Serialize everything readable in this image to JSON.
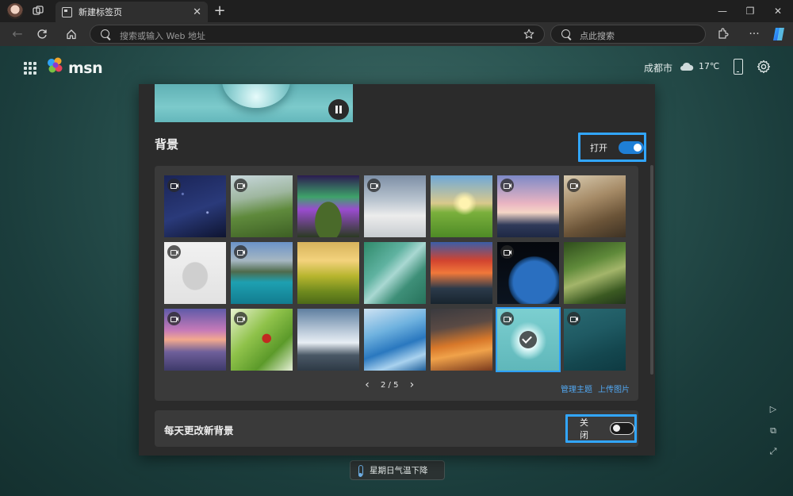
{
  "browser": {
    "tab_title": "新建标签页",
    "tab_close": "✕",
    "new_tab": "+",
    "address_placeholder": "搜索或输入 Web 地址",
    "search_placeholder": "点此搜索",
    "minimize": "—",
    "restore": "❐",
    "close": "✕"
  },
  "header": {
    "logo_text": "msn",
    "city": "成都市",
    "temperature": "17℃"
  },
  "background_panel": {
    "title": "背景",
    "toggle_label": "打开",
    "toggle_on": true,
    "page_indicator": "2 / 5",
    "manage_themes": "管理主题",
    "upload_image": "上传图片",
    "daily_title": "每天更改新背景",
    "daily_toggle_label": "关闭",
    "daily_toggle_on": false,
    "thumbnails": [
      {
        "scene": "starry-night-sky",
        "video": true,
        "selected": false
      },
      {
        "scene": "green-mountain-ridge",
        "video": true,
        "selected": false
      },
      {
        "scene": "aurora-over-mountain",
        "video": false,
        "selected": false
      },
      {
        "scene": "misty-mountains",
        "video": true,
        "selected": false
      },
      {
        "scene": "sunrise-over-meadow",
        "video": false,
        "selected": false
      },
      {
        "scene": "cliffside-sunset-village",
        "video": true,
        "selected": false
      },
      {
        "scene": "llamas",
        "video": true,
        "selected": false
      },
      {
        "scene": "white-sculpture",
        "video": true,
        "selected": false
      },
      {
        "scene": "turquoise-lake-mountains",
        "video": true,
        "selected": false
      },
      {
        "scene": "golden-hills",
        "video": false,
        "selected": false
      },
      {
        "scene": "aerial-coastline",
        "video": false,
        "selected": false
      },
      {
        "scene": "red-sky-islands",
        "video": false,
        "selected": false
      },
      {
        "scene": "planet-earth",
        "video": true,
        "selected": false
      },
      {
        "scene": "forest-path",
        "video": false,
        "selected": false
      },
      {
        "scene": "pier-at-sunset",
        "video": true,
        "selected": false
      },
      {
        "scene": "ladybug-on-leaf",
        "video": true,
        "selected": false
      },
      {
        "scene": "rocky-shore-mist",
        "video": false,
        "selected": false
      },
      {
        "scene": "iceberg-blue",
        "video": false,
        "selected": false
      },
      {
        "scene": "orange-desert-dunes",
        "video": false,
        "selected": false
      },
      {
        "scene": "water-droplet",
        "video": true,
        "selected": true
      },
      {
        "scene": "ocean-surface",
        "video": true,
        "selected": false
      }
    ]
  },
  "weather_pill": {
    "text": "星期日气温下降"
  },
  "colors": {
    "accent": "#32a6ff",
    "toggle_on": "#1f7fd6",
    "link": "#52a8f2"
  }
}
